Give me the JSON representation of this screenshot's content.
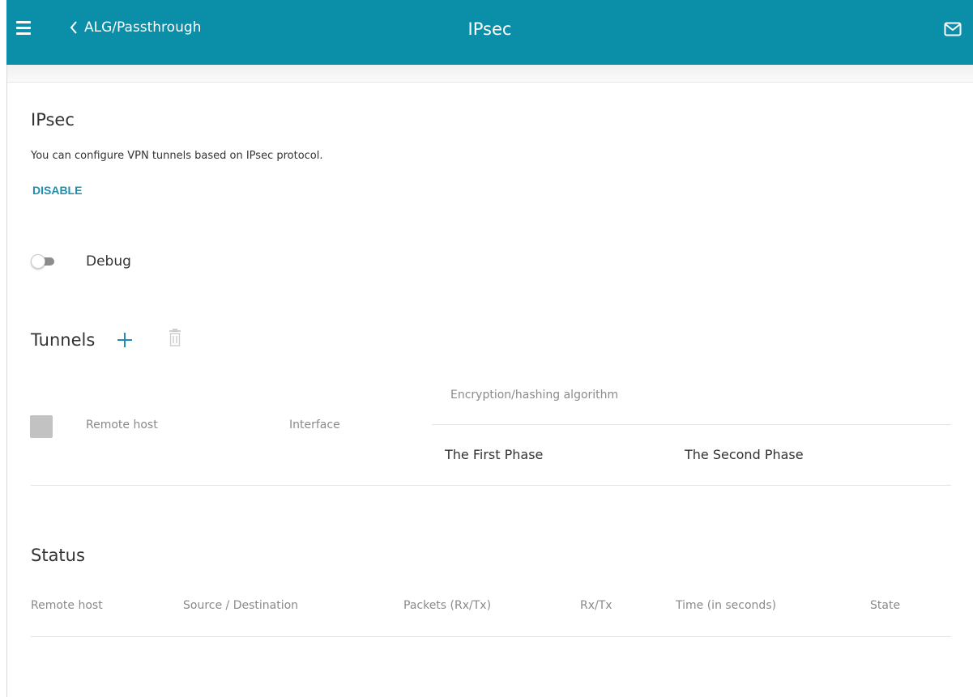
{
  "header": {
    "back_label": "ALG/Passthrough",
    "title": "IPsec",
    "menu_icon": "hamburger-icon",
    "mail_icon": "mail-icon",
    "bar_color": "#0b8ea8"
  },
  "main": {
    "title": "IPsec",
    "description": "You can configure VPN tunnels based on IPsec protocol.",
    "disable_label": "DISABLE",
    "debug": {
      "label": "Debug",
      "enabled": false
    }
  },
  "tunnels": {
    "title": "Tunnels",
    "add_icon": "plus-icon",
    "delete_icon": "trash-icon",
    "columns": {
      "remote_host": "Remote host",
      "interface": "Interface",
      "encryption": "Encryption/hashing algorithm",
      "first_phase": "The First Phase",
      "second_phase": "The Second Phase"
    },
    "rows": []
  },
  "status": {
    "title": "Status",
    "columns": [
      "Remote host",
      "Source / Destination",
      "Packets (Rx/Tx)",
      "Rx/Tx",
      "Time (in seconds)",
      "State"
    ],
    "rows": []
  },
  "colors": {
    "accent": "#0b8ea8",
    "link": "#1e8fb3"
  }
}
